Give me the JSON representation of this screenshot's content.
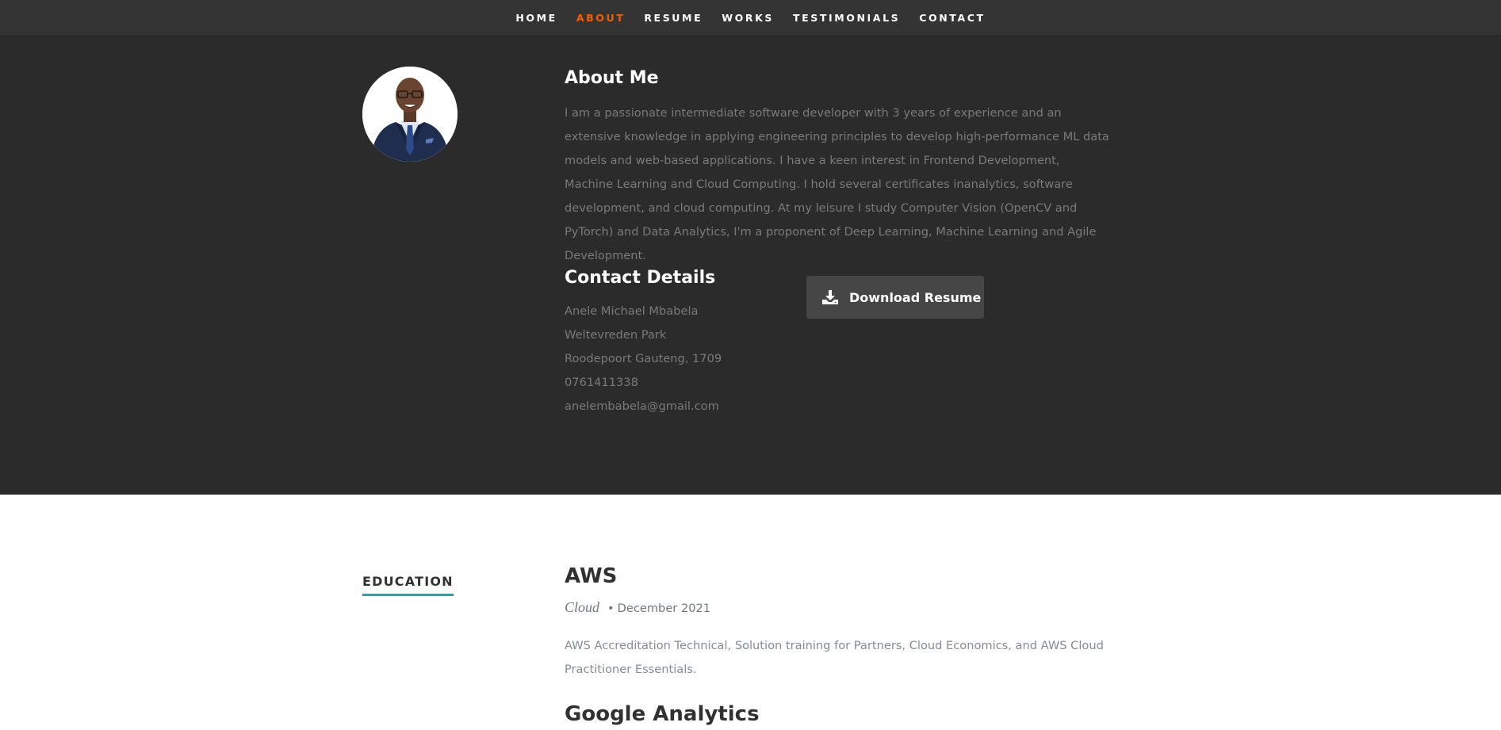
{
  "nav": {
    "items": [
      {
        "label": "HOME"
      },
      {
        "label": "ABOUT"
      },
      {
        "label": "RESUME"
      },
      {
        "label": "WORKS"
      },
      {
        "label": "TESTIMONIALS"
      },
      {
        "label": "CONTACT"
      }
    ],
    "active": "ABOUT",
    "active_color": "#f06000"
  },
  "about": {
    "title": "About Me",
    "text": "I am a passionate intermediate software developer with 3 years of experience and an extensive knowledge in applying engineering principles to develop high-performance ML data models and web-based applications. I have a keen interest in Frontend Development, Machine Learning and Cloud Computing. I hold several certificates inanalytics, software development, and cloud computing. At my leisure I study Computer Vision (OpenCV and PyTorch) and Data Analytics, I'm a proponent of Deep Learning, Machine Learning and Agile Development."
  },
  "contact": {
    "title": "Contact Details",
    "name": "Anele Michael Mbabela",
    "address1": "Weltevreden Park",
    "address2": "Roodepoort Gauteng, 1709",
    "phone": "0761411338",
    "email": "anelembabela@gmail.com"
  },
  "download": {
    "label": "Download Resume",
    "icon": "download-icon"
  },
  "education": {
    "label": "EDUCATION",
    "accent_color": "#11abb0",
    "items": [
      {
        "title": "AWS",
        "info": "Cloud",
        "date": "December 2021",
        "description": "AWS Accreditation Technical, Solution training for Partners, Cloud Economics, and AWS Cloud Practitioner Essentials."
      },
      {
        "title": "Google Analytics"
      }
    ]
  }
}
